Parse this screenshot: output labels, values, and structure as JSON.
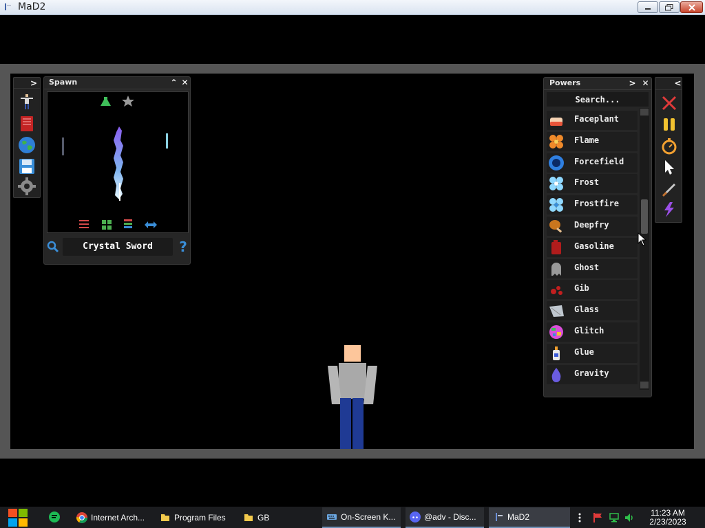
{
  "window": {
    "title": "MaD2"
  },
  "spawn": {
    "title": "Spawn",
    "selected_item": "Crystal Sword"
  },
  "powers": {
    "title": "Powers",
    "search_placeholder": "Search...",
    "items": [
      {
        "label": "Faceplant",
        "icon": "faceplant-icon",
        "color": "#e8553a"
      },
      {
        "label": "Flame",
        "icon": "flame-icon",
        "color": "#f08a2a"
      },
      {
        "label": "Forcefield",
        "icon": "forcefield-icon",
        "color": "#2f7fe0"
      },
      {
        "label": "Frost",
        "icon": "frost-icon",
        "color": "#8fd8ff"
      },
      {
        "label": "Frostfire",
        "icon": "frostfire-icon",
        "color": "#8fd8ff"
      },
      {
        "label": "Deepfry",
        "icon": "deepfry-icon",
        "color": "#c9761e"
      },
      {
        "label": "Gasoline",
        "icon": "gasoline-icon",
        "color": "#b01c1c"
      },
      {
        "label": "Ghost",
        "icon": "ghost-icon",
        "color": "#9a9a9a"
      },
      {
        "label": "Gib",
        "icon": "gib-icon",
        "color": "#c21f1f"
      },
      {
        "label": "Glass",
        "icon": "glass-icon",
        "color": "#bfc7cf"
      },
      {
        "label": "Glitch",
        "icon": "glitch-icon",
        "color": "#d94fd9"
      },
      {
        "label": "Glue",
        "icon": "glue-icon",
        "color": "#e9e9e9"
      },
      {
        "label": "Gravity",
        "icon": "gravity-icon",
        "color": "#6a5ce0"
      }
    ]
  },
  "taskbar": {
    "items": [
      {
        "label": "Internet Arch...",
        "icon": "chrome-icon"
      },
      {
        "label": "Program Files",
        "icon": "folder-icon"
      },
      {
        "label": "GB",
        "icon": "folder-icon"
      },
      {
        "label": "On-Screen K...",
        "icon": "keyboard-icon"
      },
      {
        "label": "@adv - Disc...",
        "icon": "discord-icon"
      },
      {
        "label": "MaD2",
        "icon": "mad2-icon"
      }
    ],
    "clock_time": "11:23 AM",
    "clock_date": "2/23/2023"
  }
}
